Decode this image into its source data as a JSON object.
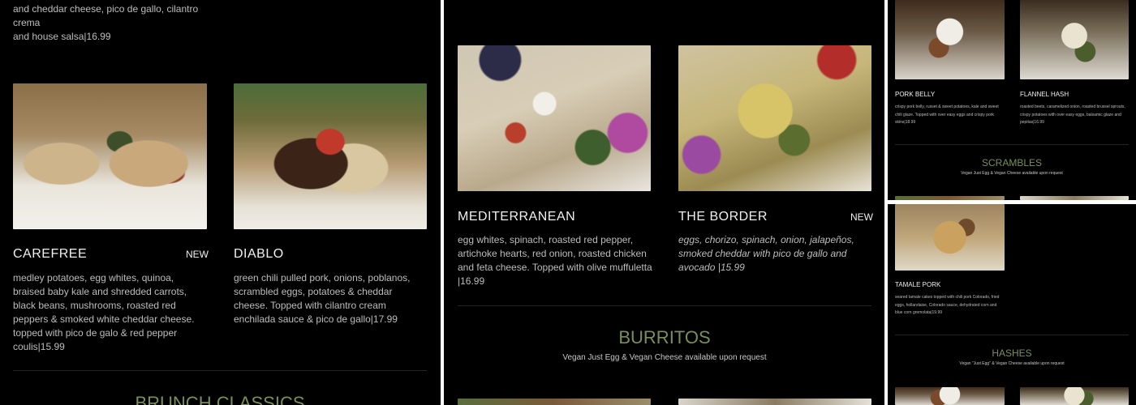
{
  "left": {
    "top_desc": "and cheddar cheese, pico de gallo, cilantro crema\nand house salsa|16.99",
    "items": [
      {
        "name": "CAREFREE",
        "badge": "NEW",
        "desc": "medley potatoes, egg whites, quinoa, braised baby kale and shredded carrots, black beans, mushrooms, roasted red peppers & smoked white cheddar cheese. topped with pico de galo & red pepper coulis|15.99"
      },
      {
        "name": "DIABLO",
        "badge": "",
        "desc": "green chili pulled pork, onions, poblanos, scrambled eggs, potatoes & cheddar cheese.  Topped with cilantro cream enchilada sauce & pico de gallo|17.99"
      }
    ],
    "section_title": "BRUNCH CLASSICS"
  },
  "middle": {
    "items": [
      {
        "name": "MEDITERRANEAN",
        "badge": "",
        "desc": "egg whites, spinach, roasted red pepper, artichoke hearts, red onion, roasted chicken and feta cheese.  Topped with olive muffuletta |16.99"
      },
      {
        "name": "THE BORDER",
        "badge": "NEW",
        "desc": "eggs, chorizo, spinach, onion, jalapeños, smoked cheddar with pico de gallo and avocado |15.99"
      }
    ],
    "section_title": "BURRITOS",
    "section_sub": "Vegan Just Egg & Vegan Cheese available upon request"
  },
  "right_top": {
    "items": [
      {
        "name": "PORK BELLY",
        "desc": "crispy pork belly, russet & sweet  potatoes, kale and sweet chili glaze.  Topped with over easy eggs and crispy pork skins|18.99"
      },
      {
        "name": "FLANNEL HASH",
        "desc": "roasted beets, caramelized onion,  roasted brussel sprouts, crispy potatoes with over easy eggs, balsamic glaze and pepitas|16.99"
      }
    ],
    "section_title": "SCRAMBLES",
    "section_sub": "Vegan Just Egg & Vegan Cheese available upon request"
  },
  "right_bottom": {
    "item": {
      "name": "TAMALE PORK",
      "desc": "seared tamale cakes topped with chili pork Colorado, fried eggs, hollandaise, Colorado sauce, dehydrated corn and blue corn gremolata|19.99"
    },
    "section_title": "HASHES",
    "section_sub": "Vegan \"Just Egg\" & Vegan Cheese available upon request"
  }
}
